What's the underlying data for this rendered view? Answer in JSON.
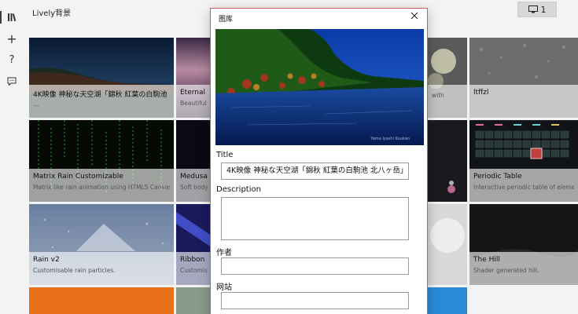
{
  "app": {
    "title": "Lively背景"
  },
  "rail": {
    "items": [
      {
        "name": "library",
        "glyph": "⫴"
      },
      {
        "name": "add",
        "glyph": "+"
      },
      {
        "name": "help",
        "glyph": "?"
      },
      {
        "name": "feedback",
        "glyph": "▭"
      }
    ]
  },
  "monitor": {
    "label": "1",
    "icon": "monitor-icon"
  },
  "tiles": [
    {
      "title": "4K映像 神秘な天空湖「錦秋 紅葉の白駒池",
      "desc": "---"
    },
    {
      "title": "Eternal Li",
      "desc": "Beautiful s"
    },
    {
      "title": "",
      "desc": "with"
    },
    {
      "title": "ltffzl",
      "desc": ""
    },
    {
      "title": "Matrix Rain Customizable",
      "desc": "Matrix like rain animation using HTML5 Canvas."
    },
    {
      "title": "Medusae",
      "desc": "Soft body s"
    },
    {
      "title": "Periodic Table",
      "desc": "Interactive periodic table of elements"
    },
    {
      "title": "Rain v2",
      "desc": "Customisable rain particles."
    },
    {
      "title": "Ribbon",
      "desc": "Customis"
    },
    {
      "title": "The Hill",
      "desc": "Shader generated hill."
    }
  ],
  "dialog": {
    "title": "图库",
    "title_label": "Title",
    "title_value": "4K映像 神秘な天空湖「錦秋 紅葉の白駒池 北八ヶ岳」",
    "description_label": "Description",
    "description_value": "",
    "author_label": "作者",
    "author_value": "",
    "website_label": "网站",
    "website_value": "",
    "preview_watermark": "Yama Iyashi Kuukan"
  },
  "colors": {
    "accent_border": "#d44a4a"
  }
}
